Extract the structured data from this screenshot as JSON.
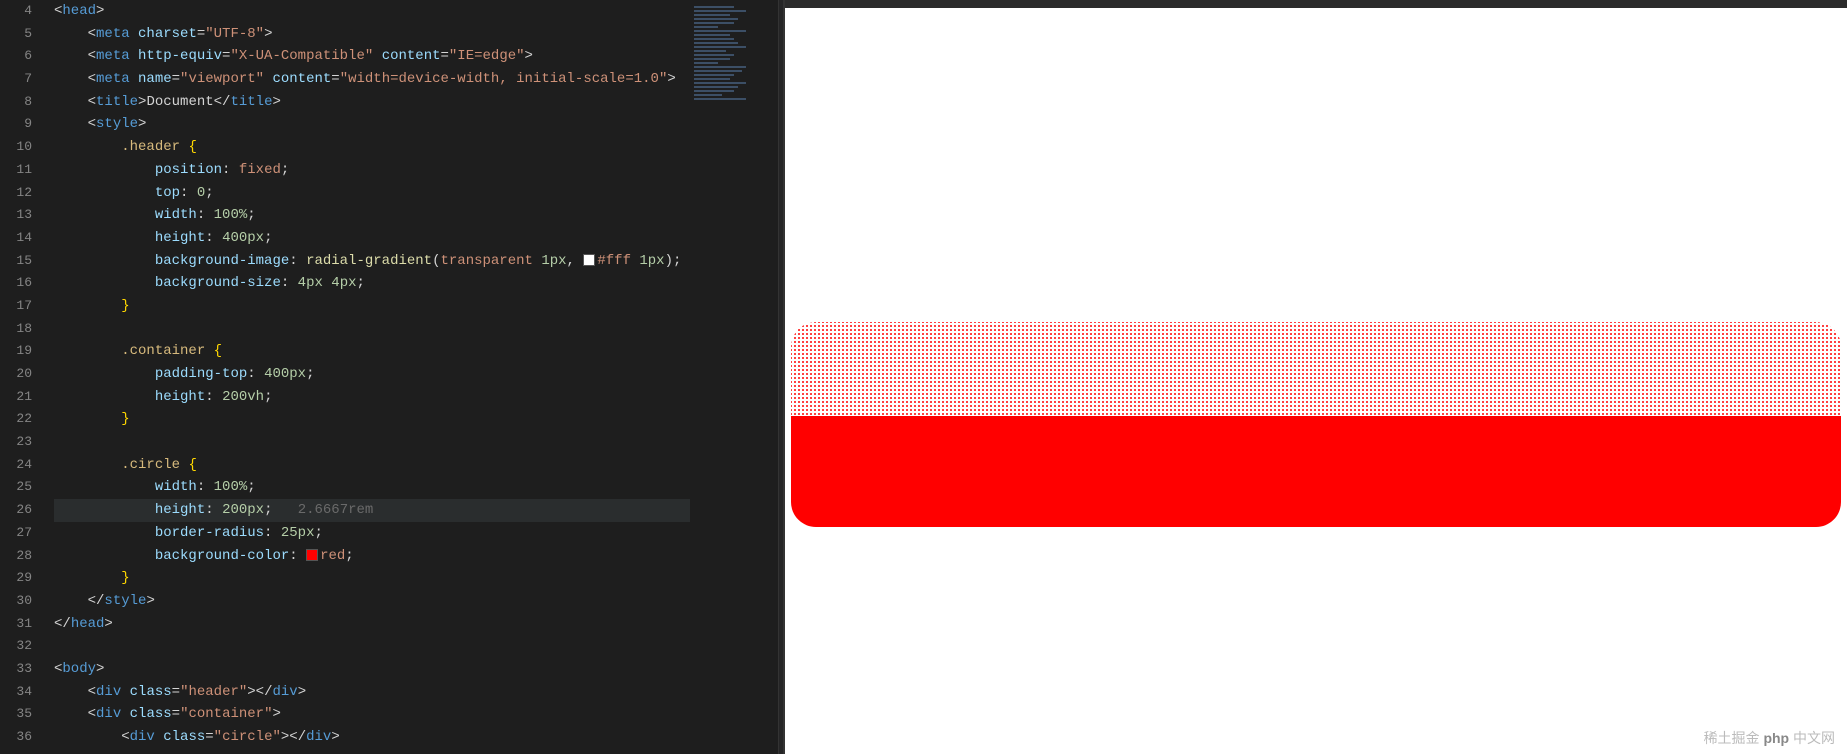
{
  "gutter": {
    "start": 4,
    "end": 36,
    "active": 26
  },
  "code": [
    {
      "n": 4,
      "html": "<span class='tok-punct'>&lt;</span><span class='tok-tag'>head</span><span class='tok-punct'>&gt;</span>"
    },
    {
      "n": 5,
      "html": "    <span class='tok-punct'>&lt;</span><span class='tok-tag'>meta</span> <span class='tok-attr'>charset</span><span class='tok-punct'>=</span><span class='tok-str'>\"UTF-8\"</span><span class='tok-punct'>&gt;</span>"
    },
    {
      "n": 6,
      "html": "    <span class='tok-punct'>&lt;</span><span class='tok-tag'>meta</span> <span class='tok-attr'>http-equiv</span><span class='tok-punct'>=</span><span class='tok-str'>\"X-UA-Compatible\"</span> <span class='tok-attr'>content</span><span class='tok-punct'>=</span><span class='tok-str'>\"IE=edge\"</span><span class='tok-punct'>&gt;</span>"
    },
    {
      "n": 7,
      "html": "    <span class='tok-punct'>&lt;</span><span class='tok-tag'>meta</span> <span class='tok-attr'>name</span><span class='tok-punct'>=</span><span class='tok-str'>\"viewport\"</span> <span class='tok-attr'>content</span><span class='tok-punct'>=</span><span class='tok-str'>\"width=device-width, initial-scale=1.0\"</span><span class='tok-punct'>&gt;</span>"
    },
    {
      "n": 8,
      "html": "    <span class='tok-punct'>&lt;</span><span class='tok-tag'>title</span><span class='tok-punct'>&gt;</span><span class='tok-title'>Document</span><span class='tok-punct'>&lt;/</span><span class='tok-tag'>title</span><span class='tok-punct'>&gt;</span>"
    },
    {
      "n": 9,
      "html": "    <span class='tok-punct'>&lt;</span><span class='tok-tag'>style</span><span class='tok-punct'>&gt;</span>"
    },
    {
      "n": 10,
      "html": "        <span class='tok-sel'>.header</span> <span class='tok-brace'>{</span>"
    },
    {
      "n": 11,
      "html": "            <span class='tok-prop'>position</span><span class='tok-punct'>:</span> <span class='tok-val'>fixed</span><span class='tok-punct'>;</span>"
    },
    {
      "n": 12,
      "html": "            <span class='tok-prop'>top</span><span class='tok-punct'>:</span> <span class='tok-num'>0</span><span class='tok-punct'>;</span>"
    },
    {
      "n": 13,
      "html": "            <span class='tok-prop'>width</span><span class='tok-punct'>:</span> <span class='tok-num'>100%</span><span class='tok-punct'>;</span>"
    },
    {
      "n": 14,
      "html": "            <span class='tok-prop'>height</span><span class='tok-punct'>:</span> <span class='tok-num'>400px</span><span class='tok-punct'>;</span>"
    },
    {
      "n": 15,
      "html": "            <span class='tok-prop'>background-image</span><span class='tok-punct'>:</span> <span class='tok-func'>radial-gradient</span><span class='tok-punct'>(</span><span class='tok-val'>transparent</span> <span class='tok-num'>1px</span><span class='tok-punct'>,</span> <span class='color-swatch sw-white'></span><span class='tok-val'>#fff</span> <span class='tok-num'>1px</span><span class='tok-punct'>);</span>"
    },
    {
      "n": 16,
      "html": "            <span class='tok-prop'>background-size</span><span class='tok-punct'>:</span> <span class='tok-num'>4px</span> <span class='tok-num'>4px</span><span class='tok-punct'>;</span>"
    },
    {
      "n": 17,
      "html": "        <span class='tok-brace'>}</span>"
    },
    {
      "n": 18,
      "html": ""
    },
    {
      "n": 19,
      "html": "        <span class='tok-sel'>.container</span> <span class='tok-brace'>{</span>"
    },
    {
      "n": 20,
      "html": "            <span class='tok-prop'>padding-top</span><span class='tok-punct'>:</span> <span class='tok-num'>400px</span><span class='tok-punct'>;</span>"
    },
    {
      "n": 21,
      "html": "            <span class='tok-prop'>height</span><span class='tok-punct'>:</span> <span class='tok-num'>200vh</span><span class='tok-punct'>;</span>"
    },
    {
      "n": 22,
      "html": "        <span class='tok-brace'>}</span>"
    },
    {
      "n": 23,
      "html": ""
    },
    {
      "n": 24,
      "html": "        <span class='tok-sel'>.circle</span> <span class='tok-brace'>{</span>"
    },
    {
      "n": 25,
      "html": "            <span class='tok-prop'>width</span><span class='tok-punct'>:</span> <span class='tok-num'>100%</span><span class='tok-punct'>;</span>"
    },
    {
      "n": 26,
      "active": true,
      "html": "            <span class='tok-prop'>height</span><span class='tok-punct'>:</span> <span class='tok-num'>200px</span><span class='tok-punct'>;</span>   <span class='tok-hint'>2.6667rem</span>"
    },
    {
      "n": 27,
      "html": "            <span class='tok-prop'>border-radius</span><span class='tok-punct'>:</span> <span class='tok-num'>25px</span><span class='tok-punct'>;</span>"
    },
    {
      "n": 28,
      "html": "            <span class='tok-prop'>background-color</span><span class='tok-punct'>:</span> <span class='color-swatch sw-red'></span><span class='tok-val'>red</span><span class='tok-punct'>;</span>"
    },
    {
      "n": 29,
      "html": "        <span class='tok-brace'>}</span>"
    },
    {
      "n": 30,
      "html": "    <span class='tok-punct'>&lt;/</span><span class='tok-tag'>style</span><span class='tok-punct'>&gt;</span>"
    },
    {
      "n": 31,
      "html": "<span class='tok-punct'>&lt;/</span><span class='tok-tag'>head</span><span class='tok-punct'>&gt;</span>"
    },
    {
      "n": 32,
      "html": ""
    },
    {
      "n": 33,
      "html": "<span class='tok-punct'>&lt;</span><span class='tok-tag'>body</span><span class='tok-punct'>&gt;</span>"
    },
    {
      "n": 34,
      "html": "    <span class='tok-punct'>&lt;</span><span class='tok-tag'>div</span> <span class='tok-attr'>class</span><span class='tok-punct'>=</span><span class='tok-str'>\"header\"</span><span class='tok-punct'>&gt;&lt;/</span><span class='tok-tag'>div</span><span class='tok-punct'>&gt;</span>"
    },
    {
      "n": 35,
      "html": "    <span class='tok-punct'>&lt;</span><span class='tok-tag'>div</span> <span class='tok-attr'>class</span><span class='tok-punct'>=</span><span class='tok-str'>\"container\"</span><span class='tok-punct'>&gt;</span>"
    },
    {
      "n": 36,
      "html": "        <span class='tok-punct'>&lt;</span><span class='tok-tag'>div</span> <span class='tok-attr'>class</span><span class='tok-punct'>=</span><span class='tok-str'>\"circle\"</span><span class='tok-punct'>&gt;&lt;/</span><span class='tok-tag'>div</span><span class='tok-punct'>&gt;</span>"
    }
  ],
  "watermark": {
    "juejin": "稀土掘金",
    "php": "php",
    "cn": "中文网"
  },
  "minimap_lines": [
    "w2",
    "w3",
    "w4",
    "w5",
    "w2",
    "w1",
    "w3",
    "w4",
    "w2",
    "w5",
    "w3",
    "w6",
    "w2",
    "w4",
    "w1",
    "w3",
    "w7",
    "w2",
    "w4",
    "w3",
    "w5",
    "w2",
    "w8",
    "w3"
  ],
  "colors": {
    "red": "#ff0000",
    "white": "#ffffff",
    "bg_editor": "#1e1e1e"
  }
}
